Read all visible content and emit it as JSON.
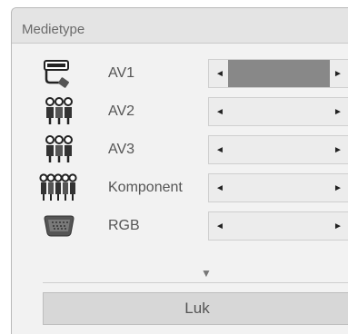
{
  "dialog": {
    "title": "Medietype"
  },
  "rows": [
    {
      "label": "AV1",
      "icon": "scart-connector-icon",
      "active": true
    },
    {
      "label": "AV2",
      "icon": "composite-av-connector-icon",
      "active": false
    },
    {
      "label": "AV3",
      "icon": "composite-av-connector-icon",
      "active": false
    },
    {
      "label": "Komponent",
      "icon": "component-connector-icon",
      "active": false
    },
    {
      "label": "RGB",
      "icon": "vga-connector-icon",
      "active": false
    }
  ],
  "arrows": {
    "left": "◄",
    "right": "►",
    "more": "▼"
  },
  "footer": {
    "close_label": "Luk"
  },
  "colors": {
    "active_fill": "#888888",
    "inactive_fill": "#ececec"
  }
}
